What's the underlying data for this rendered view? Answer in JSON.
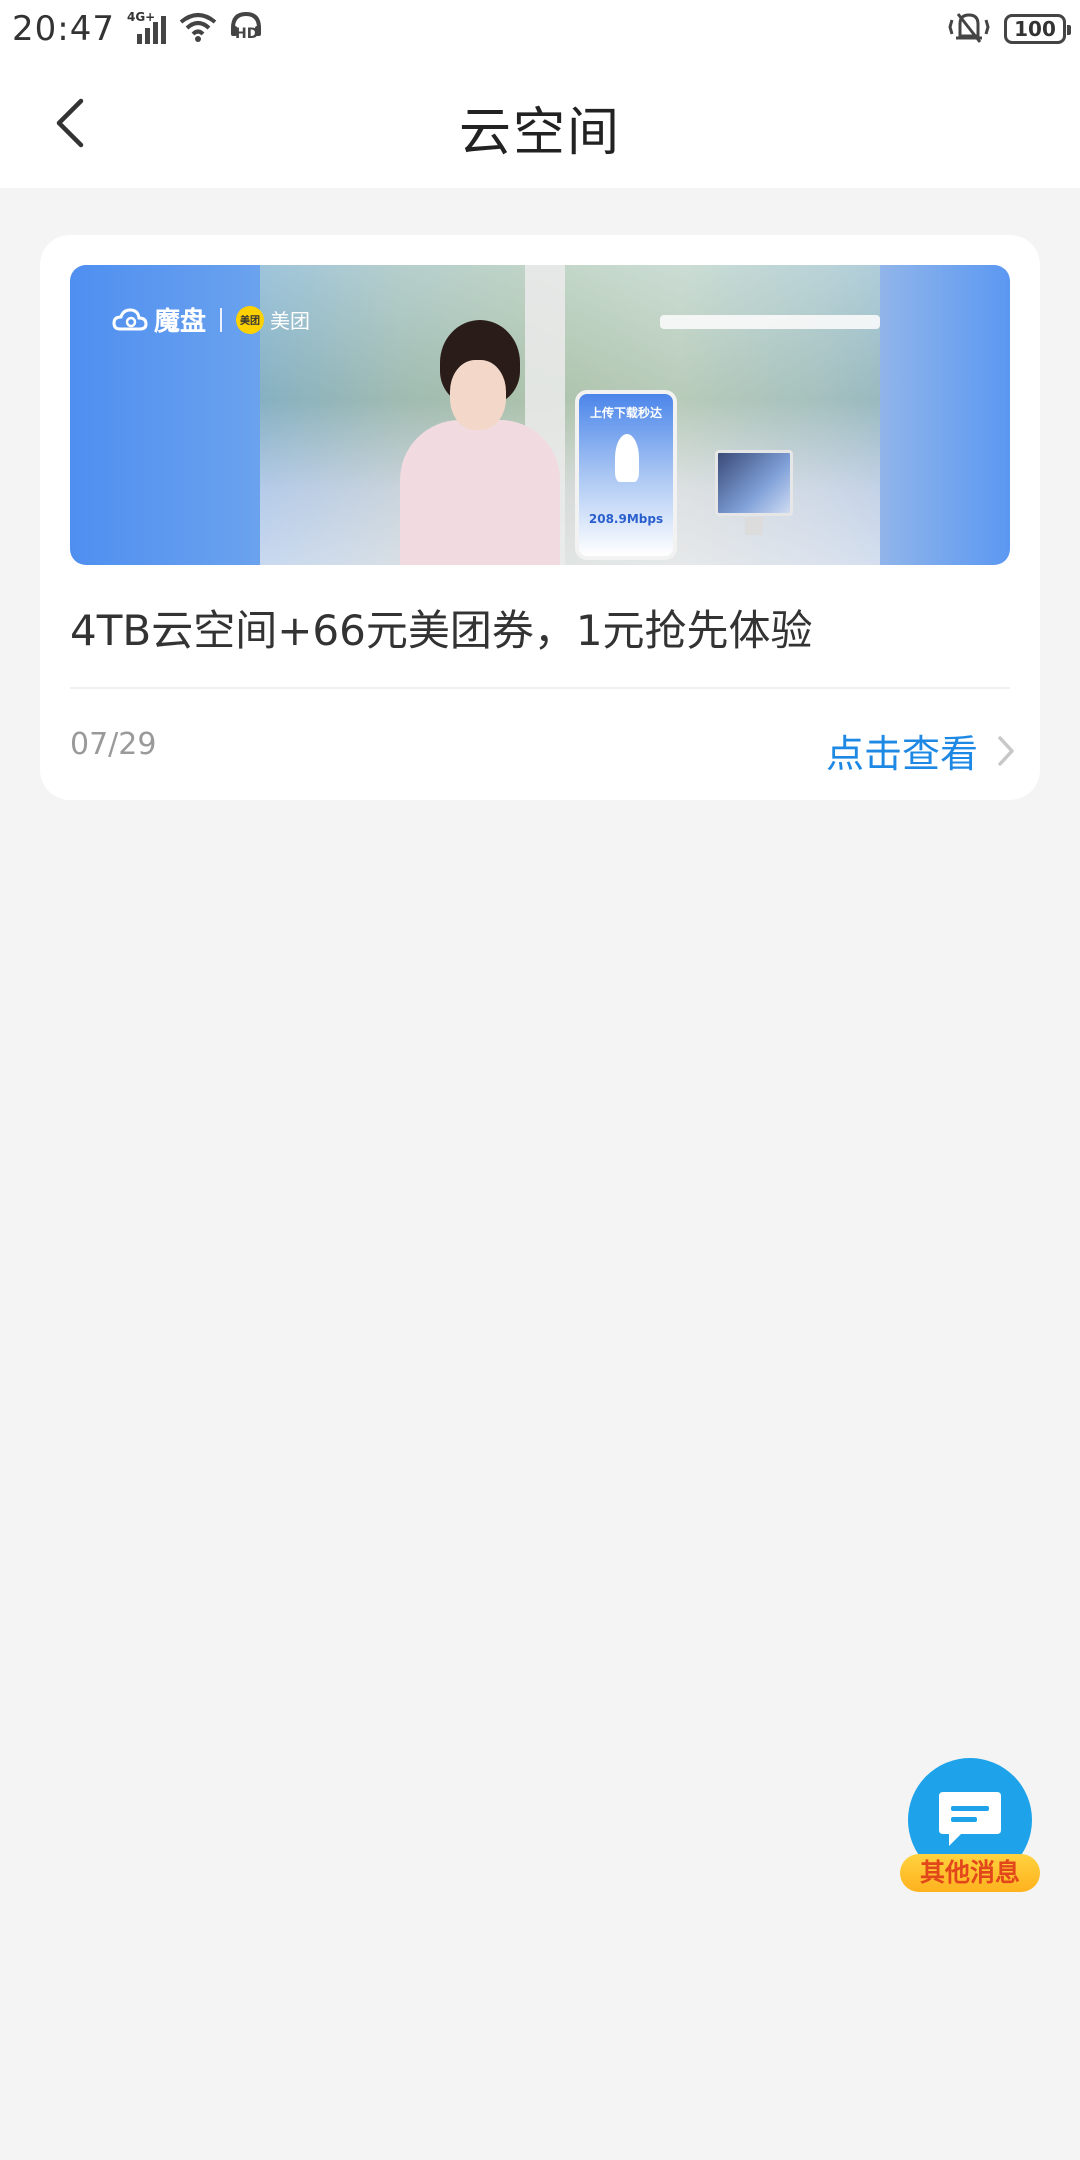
{
  "status_bar": {
    "time": "20:47",
    "network": "4G+",
    "hd": "HD",
    "battery": "100"
  },
  "header": {
    "title": "云空间"
  },
  "card": {
    "banner": {
      "brand": "魔盘",
      "partner": "美团",
      "phone_headline": "上传下载秒达",
      "phone_speed": "208.9Mbps"
    },
    "title": "4TB云空间+66元美团券，1元抢先体验",
    "date": "07/29",
    "link_label": "点击查看"
  },
  "fab": {
    "label": "其他消息"
  },
  "colors": {
    "accent": "#1e88e5",
    "background": "#f4f4f4",
    "fab_blue": "#1ea3ea",
    "fab_badge": "#ffc12e"
  }
}
